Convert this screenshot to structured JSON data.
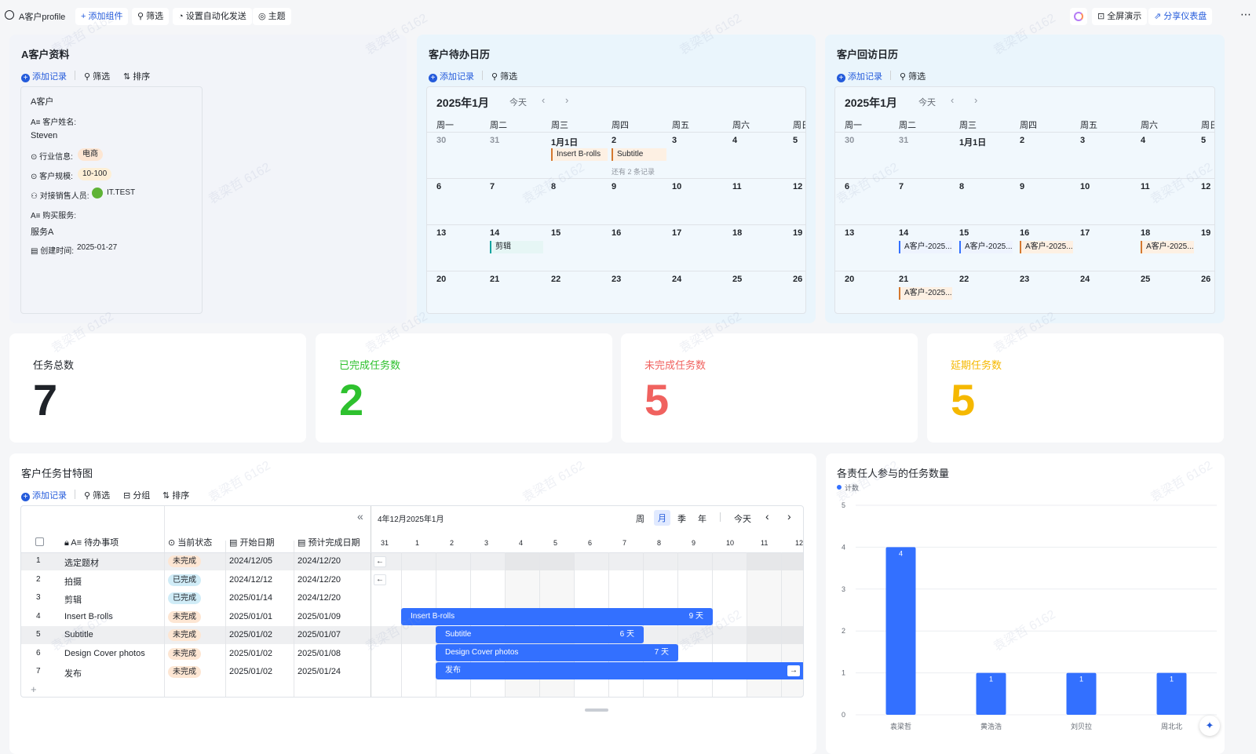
{
  "topbar": {
    "title": "A客户profile",
    "add_widget": "添加组件",
    "filter": "筛选",
    "automation": "设置自动化发送",
    "theme": "主题",
    "fullscreen": "全屏演示",
    "share": "分享仪表盘"
  },
  "profile_card": {
    "title": "A客户资料",
    "add_record": "添加记录",
    "filter": "筛选",
    "sort": "排序",
    "record": {
      "heading": "A客户",
      "name_label": "客户姓名:",
      "name_value": "Steven",
      "industry_label": "行业信息:",
      "industry_value": "电商",
      "scale_label": "客户规模:",
      "scale_value": "10-100",
      "sales_label": "对接销售人员:",
      "sales_value": "IT.TEST",
      "service_label": "购买服务:",
      "service_value": "服务A",
      "created_label": "创建时间:",
      "created_value": "2025-01-27"
    }
  },
  "todo_calendar": {
    "title": "客户待办日历",
    "add_record": "添加记录",
    "filter": "筛选",
    "month": "2025年1月",
    "today": "今天",
    "weekdays": [
      "周一",
      "周二",
      "周三",
      "周四",
      "周五",
      "周六",
      "周日"
    ],
    "weeks": [
      [
        "30",
        "31",
        "1月1日",
        "2",
        "3",
        "4",
        "5"
      ],
      [
        "6",
        "7",
        "8",
        "9",
        "10",
        "11",
        "12"
      ],
      [
        "13",
        "14",
        "15",
        "16",
        "17",
        "18",
        "19"
      ],
      [
        "20",
        "21",
        "22",
        "23",
        "24",
        "25",
        "26"
      ]
    ],
    "events": {
      "e1": "Insert B-rolls",
      "e2": "Subtitle",
      "more": "还有 2 条记录",
      "e3": "剪辑"
    }
  },
  "visit_calendar": {
    "title": "客户回访日历",
    "add_record": "添加记录",
    "filter": "筛选",
    "month": "2025年1月",
    "today": "今天",
    "weekdays": [
      "周一",
      "周二",
      "周三",
      "周四",
      "周五",
      "周六",
      "周日"
    ],
    "weeks": [
      [
        "30",
        "31",
        "1月1日",
        "2",
        "3",
        "4",
        "5"
      ],
      [
        "6",
        "7",
        "8",
        "9",
        "10",
        "11",
        "12"
      ],
      [
        "13",
        "14",
        "15",
        "16",
        "17",
        "18",
        "19"
      ],
      [
        "20",
        "21",
        "22",
        "23",
        "24",
        "25",
        "26"
      ]
    ],
    "events": {
      "e14": "A客户-2025...",
      "e15": "A客户-2025...",
      "e16": "A客户-2025...",
      "e18": "A客户-2025...",
      "e21": "A客户-2025..."
    }
  },
  "stats": [
    {
      "label": "任务总数",
      "value": "7",
      "color": "#1f2329"
    },
    {
      "label": "已完成任务数",
      "value": "2",
      "color": "#2ec12e"
    },
    {
      "label": "未完成任务数",
      "value": "5",
      "color": "#f0625f"
    },
    {
      "label": "延期任务数",
      "value": "5",
      "color": "#f5b800"
    }
  ],
  "gantt": {
    "title": "客户任务甘特图",
    "add_record": "添加记录",
    "filter": "筛选",
    "group": "分组",
    "sort": "排序",
    "collapse": "«",
    "period": "4年12月2025年1月",
    "views": {
      "week": "周",
      "month": "月",
      "quarter": "季",
      "year": "年"
    },
    "today": "今天",
    "headers": {
      "task": "待办事项",
      "status": "当前状态",
      "start": "开始日期",
      "end": "预计完成日期"
    },
    "days": [
      "31",
      "1",
      "2",
      "3",
      "4",
      "5",
      "6",
      "7",
      "8",
      "9",
      "10",
      "11",
      "12"
    ],
    "rows": [
      {
        "no": "1",
        "task": "选定题材",
        "status": "未完成",
        "start": "2024/12/05",
        "end": "2024/12/20",
        "done": false
      },
      {
        "no": "2",
        "task": "拍摄",
        "status": "已完成",
        "start": "2024/12/12",
        "end": "2024/12/20",
        "done": true
      },
      {
        "no": "3",
        "task": "剪辑",
        "status": "已完成",
        "start": "2025/01/14",
        "end": "2024/12/20",
        "done": true
      },
      {
        "no": "4",
        "task": "Insert B-rolls",
        "status": "未完成",
        "start": "2025/01/01",
        "end": "2025/01/09",
        "done": false
      },
      {
        "no": "5",
        "task": "Subtitle",
        "status": "未完成",
        "start": "2025/01/02",
        "end": "2025/01/07",
        "done": false
      },
      {
        "no": "6",
        "task": "Design Cover photos",
        "status": "未完成",
        "start": "2025/01/02",
        "end": "2025/01/08",
        "done": false
      },
      {
        "no": "7",
        "task": "发布",
        "status": "未完成",
        "start": "2025/01/02",
        "end": "2025/01/24",
        "done": false
      }
    ],
    "bars": [
      {
        "label": "Insert B-rolls",
        "duration": "9 天"
      },
      {
        "label": "Subtitle",
        "duration": "6 天"
      },
      {
        "label": "Design Cover photos",
        "duration": "7 天"
      },
      {
        "label": "发布",
        "duration": ""
      }
    ],
    "add_row": "+"
  },
  "chart_data": {
    "type": "bar",
    "title": "各责任人参与的任务数量",
    "legend": [
      "计数"
    ],
    "categories": [
      "袁梁哲",
      "黄浩浩",
      "刘贝拉",
      "周北北"
    ],
    "series": [
      {
        "name": "计数",
        "values": [
          4,
          1,
          1,
          1
        ]
      }
    ],
    "ylim": [
      0,
      5
    ],
    "yticks": [
      "0",
      "1",
      "2",
      "3",
      "4",
      "5"
    ],
    "bar_color": "#3370ff",
    "grid": true,
    "legend_position": "top-left"
  },
  "watermark": "袁梁哲 6162"
}
